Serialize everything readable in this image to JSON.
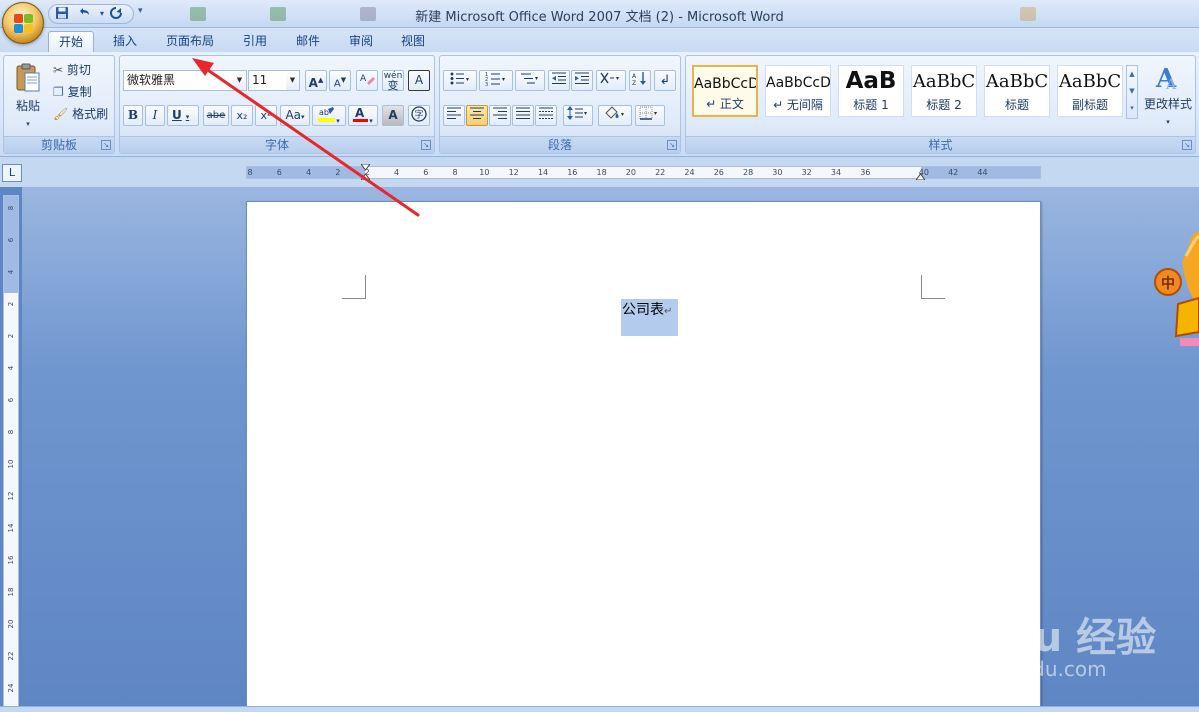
{
  "window": {
    "title": "新建 Microsoft Office Word 2007 文档 (2) - Microsoft Word"
  },
  "qat": {
    "save_icon": "save-icon",
    "undo_icon": "undo-icon",
    "redo_icon": "redo-icon"
  },
  "tabs": [
    {
      "label": "开始",
      "active": true
    },
    {
      "label": "插入",
      "active": false
    },
    {
      "label": "页面布局",
      "active": false
    },
    {
      "label": "引用",
      "active": false
    },
    {
      "label": "邮件",
      "active": false
    },
    {
      "label": "审阅",
      "active": false
    },
    {
      "label": "视图",
      "active": false
    }
  ],
  "clipboard": {
    "group_label": "剪贴板",
    "paste_label": "粘贴",
    "cut_label": "剪切",
    "copy_label": "复制",
    "format_painter_label": "格式刷"
  },
  "font": {
    "group_label": "字体",
    "font_name": "微软雅黑",
    "font_size": "11",
    "bold": "B",
    "italic": "I",
    "underline": "U",
    "strike": "abe",
    "subscript": "x₂",
    "superscript": "x²",
    "change_case": "Aa",
    "phonetic": "wén",
    "phonetic_sub": "变",
    "char_border": "A",
    "char_shade": "A",
    "enclose": "字",
    "highlight_color": "#ffff00",
    "font_color": "#ff0000"
  },
  "paragraph": {
    "group_label": "段落"
  },
  "styles": {
    "group_label": "样式",
    "items": [
      {
        "sample": "AaBbCcD",
        "name": "↵ 正文",
        "selected": true
      },
      {
        "sample": "AaBbCcD",
        "name": "↵ 无间隔",
        "selected": false
      },
      {
        "sample": "AaB",
        "name": "标题 1",
        "selected": false
      },
      {
        "sample": "AaBbC",
        "name": "标题 2",
        "selected": false
      },
      {
        "sample": "AaBbC",
        "name": "标题",
        "selected": false
      },
      {
        "sample": "AaBbC",
        "name": "副标题",
        "selected": false
      }
    ],
    "change_styles_label": "更改样式"
  },
  "ruler": {
    "corner": "L",
    "h_ticks": [
      "8",
      "6",
      "4",
      "2",
      "2",
      "4",
      "6",
      "8",
      "10",
      "12",
      "14",
      "16",
      "18",
      "20",
      "22",
      "24",
      "26",
      "28",
      "30",
      "32",
      "34",
      "36",
      "40",
      "42",
      "44"
    ],
    "v_ticks": [
      "8",
      "6",
      "4",
      "2",
      "2",
      "4",
      "6",
      "8",
      "10",
      "12",
      "14",
      "16",
      "18",
      "20",
      "22",
      "24"
    ]
  },
  "document": {
    "text": "公司表",
    "paragraph_mark": "↵"
  },
  "watermark": {
    "main": "Bai du 经验",
    "sub": "jingyan.baidu.com"
  },
  "colors": {
    "accent": "#15428b",
    "annotation_arrow": "#e8262b"
  }
}
